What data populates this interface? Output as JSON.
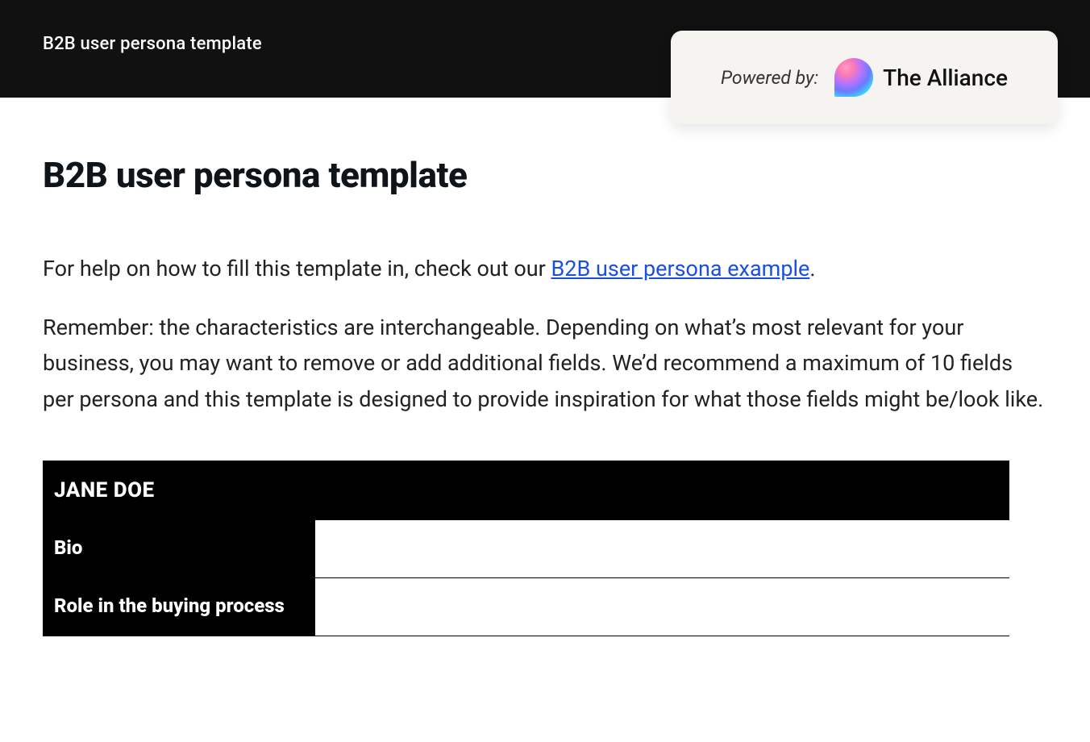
{
  "topbar": {
    "title": "B2B user persona template"
  },
  "powered": {
    "label": "Powered by:",
    "brand": "The Alliance"
  },
  "page": {
    "title": "B2B user persona template"
  },
  "intro": {
    "p1_prefix": "For help on how to fill this template in, check out our ",
    "p1_link": "B2B user persona example",
    "p1_suffix": ".",
    "p2": "Remember: the characteristics are interchangeable. Depending on what’s most relevant for your business, you may want to remove or add additional fields. We’d recommend a maximum of 10 fields per persona and this template is designed to provide inspiration for what those fields might be/look like."
  },
  "persona": {
    "name": "JANE DOE",
    "rows": [
      {
        "label": "Bio",
        "value": ""
      },
      {
        "label": "Role in the buying process",
        "value": ""
      }
    ]
  }
}
